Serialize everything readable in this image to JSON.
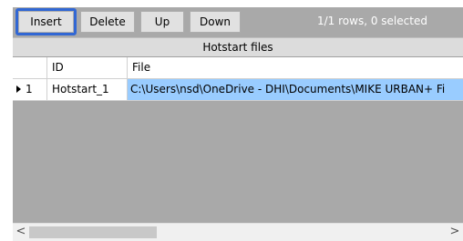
{
  "toolbar": {
    "insert_label": "Insert",
    "delete_label": "Delete",
    "up_label": "Up",
    "down_label": "Down",
    "status": "1/1 rows, 0 selected"
  },
  "grid": {
    "caption": "Hotstart files",
    "columns": [
      "",
      "ID",
      "File"
    ],
    "rows": [
      {
        "row_label": "1",
        "id": "Hotstart_1",
        "file": "C:\\Users\\nsd\\OneDrive - DHI\\Documents\\MIKE URBAN+ Fi"
      }
    ]
  },
  "scrollbar": {
    "left_arrow": "<",
    "right_arrow": ">"
  },
  "colors": {
    "focus_ring": "#3167d4",
    "selected_cell": "#99ccff",
    "empty_area": "#a9a9a9"
  }
}
